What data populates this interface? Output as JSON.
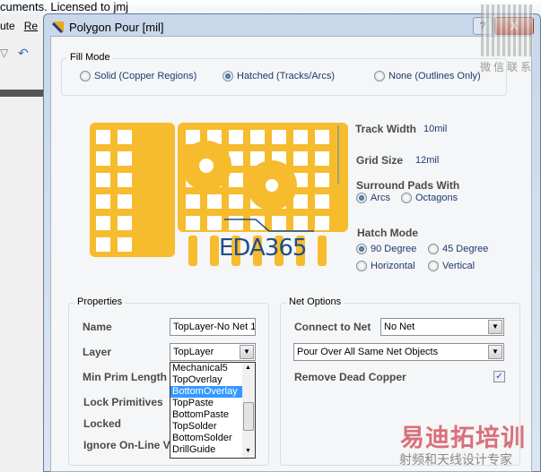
{
  "background_window": {
    "title": "cuments. Licensed to jmj",
    "menu": [
      "ute",
      "Re"
    ]
  },
  "dialog": {
    "title": "Polygon Pour [mil]",
    "help": "?",
    "close": "X"
  },
  "fill_mode": {
    "label": "Fill Mode",
    "options": [
      "Solid (Copper Regions)",
      "Hatched (Tracks/Arcs)",
      "None (Outlines Only)"
    ],
    "selected": "Hatched (Tracks/Arcs)"
  },
  "preview": {
    "logo": "EDA365",
    "copper_color": "#f7bb2e",
    "accent": "#1f4e8a"
  },
  "hatch": {
    "track_width_label": "Track Width",
    "track_width": "10mil",
    "grid_size_label": "Grid Size",
    "grid_size": "12mil",
    "surround_label": "Surround Pads With",
    "surround_options": [
      "Arcs",
      "Octagons"
    ],
    "surround_selected": "Arcs",
    "hatch_mode_label": "Hatch Mode",
    "hatch_options": [
      "90 Degree",
      "45 Degree",
      "Horizontal",
      "Vertical"
    ],
    "hatch_selected": "90 Degree"
  },
  "properties": {
    "label": "Properties",
    "name_label": "Name",
    "name_value": "TopLayer-No Net 1",
    "layer_label": "Layer",
    "layer_value": "TopLayer",
    "min_prim_label": "Min Prim Length",
    "lock_prim_label": "Lock Primitives",
    "locked_label": "Locked",
    "ignore_label": "Ignore On-Line V",
    "layer_dropdown": [
      "Mechanical5",
      "TopOverlay",
      "BottomOverlay",
      "TopPaste",
      "BottomPaste",
      "TopSolder",
      "BottomSolder",
      "DrillGuide"
    ],
    "layer_highlighted": "BottomOverlay"
  },
  "net_options": {
    "label": "Net Options",
    "connect_label": "Connect to Net",
    "connect_value": "No Net",
    "pour_value": "Pour Over All Same Net Objects",
    "remove_dead_label": "Remove Dead Copper",
    "remove_dead_checked": true
  },
  "watermarks": {
    "qr_caption": "微信联系",
    "brand": "易迪拓培训",
    "slogan": "射频和天线设计专家"
  }
}
